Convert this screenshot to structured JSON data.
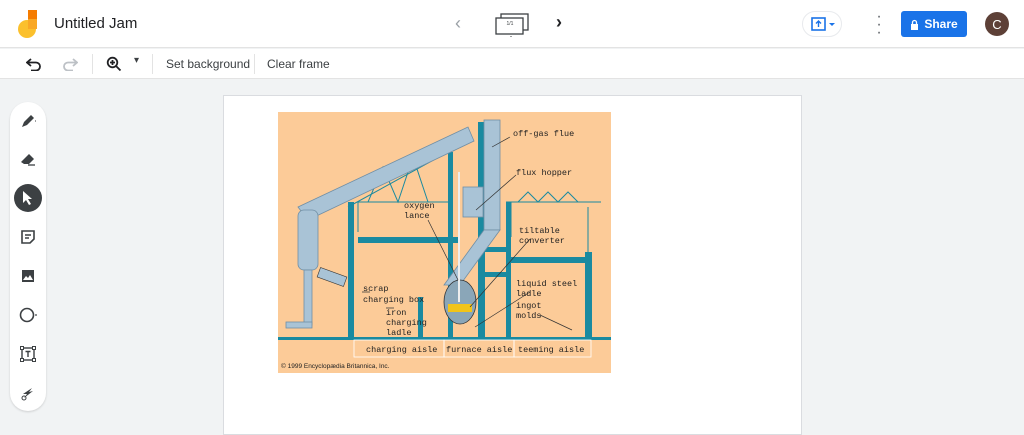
{
  "header": {
    "title": "Untitled Jam",
    "frame_counter": "1/1",
    "share_label": "Share",
    "avatar_initial": "C"
  },
  "toolbar": {
    "set_background": "Set background",
    "clear_frame": "Clear frame"
  },
  "tools": [
    "pen",
    "eraser",
    "select",
    "sticky-note",
    "image",
    "circle",
    "text-box",
    "laser"
  ],
  "diagram": {
    "labels": {
      "off_gas_flue": "off-gas flue",
      "flux_hopper": "flux hopper",
      "oxygen": "oxygen",
      "lance": "lance",
      "tiltable": "tiltable",
      "converter": "converter",
      "scrap": "scrap",
      "charging_box": "charging box",
      "iron": "iron",
      "charging": "charging",
      "ladle": "ladle",
      "liquid_steel": "liquid steel",
      "ladle2": "ladle",
      "ingot": "ingot",
      "molds": "molds",
      "charging_aisle": "charging aisle",
      "furnace_aisle": "furnace aisle",
      "teeming_aisle": "teeming aisle"
    },
    "credit": "© 1999 Encyclopædia Britannica, Inc.",
    "colors": {
      "background": "#fccb98",
      "steel": "#1a8aa0",
      "duct": "#a9c3d6"
    }
  }
}
